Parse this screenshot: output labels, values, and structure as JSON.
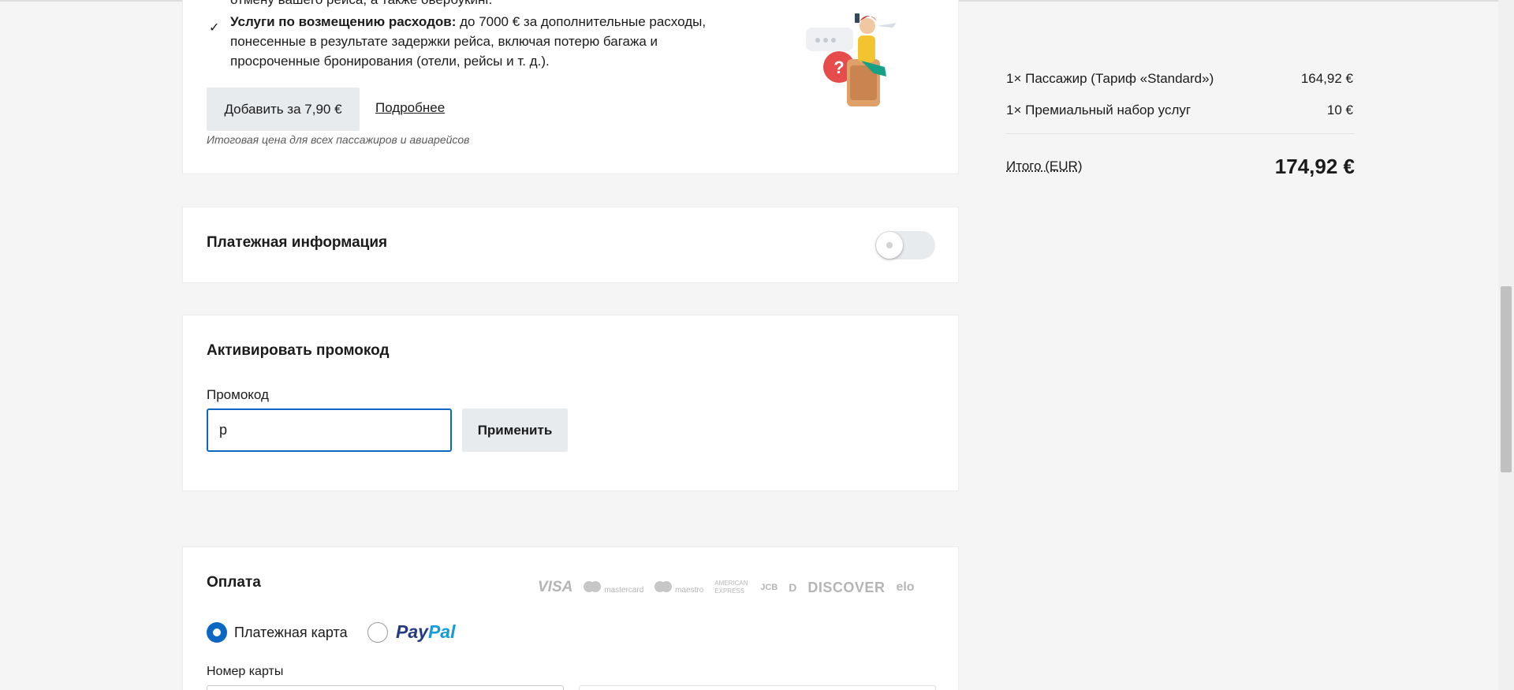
{
  "insurance": {
    "line_top": "отмену вашего рейса, а также овербукинг.",
    "item_bold": "Услуги по возмещению расходов:",
    "item_text_1": " до 7000 € за дополнительные расходы,",
    "item_text_2": "понесенные в результате задержки рейса, включая потерю багажа и",
    "item_text_3": "просроченные бронирования (отели, рейсы и т. д.).",
    "add_button": "Добавить за 7,90 €",
    "more_link": "Подробнее",
    "note": "Итоговая цена для всех пассажиров и авиарейсов"
  },
  "payment_info": {
    "title": "Платежная информация",
    "toggle_on": false
  },
  "promo": {
    "title": "Активировать промокод",
    "label": "Промокод",
    "value": "p",
    "apply_button": "Применить"
  },
  "payment": {
    "title": "Оплата",
    "brands": [
      "VISA",
      "mastercard",
      "maestro",
      "AMERICAN EXPRESS",
      "JCB",
      "D",
      "DISCOVER",
      "elo"
    ],
    "option_card": "Платежная карта",
    "option_paypal_1": "Pay",
    "option_paypal_2": "Pal",
    "selected": "card",
    "card_number_label": "Номер карты"
  },
  "summary": {
    "rows": [
      {
        "label": "1× Пассажир (Тариф «Standard»)",
        "value": "164,92 €"
      },
      {
        "label": "1× Премиальный набор услуг",
        "value": "10 €"
      }
    ],
    "total_label": "Итого (EUR)",
    "total_value": "174,92 €"
  },
  "colors": {
    "accent": "#0b67c2",
    "button_bg": "#e8ebee",
    "page_bg": "#f5f5f5"
  }
}
